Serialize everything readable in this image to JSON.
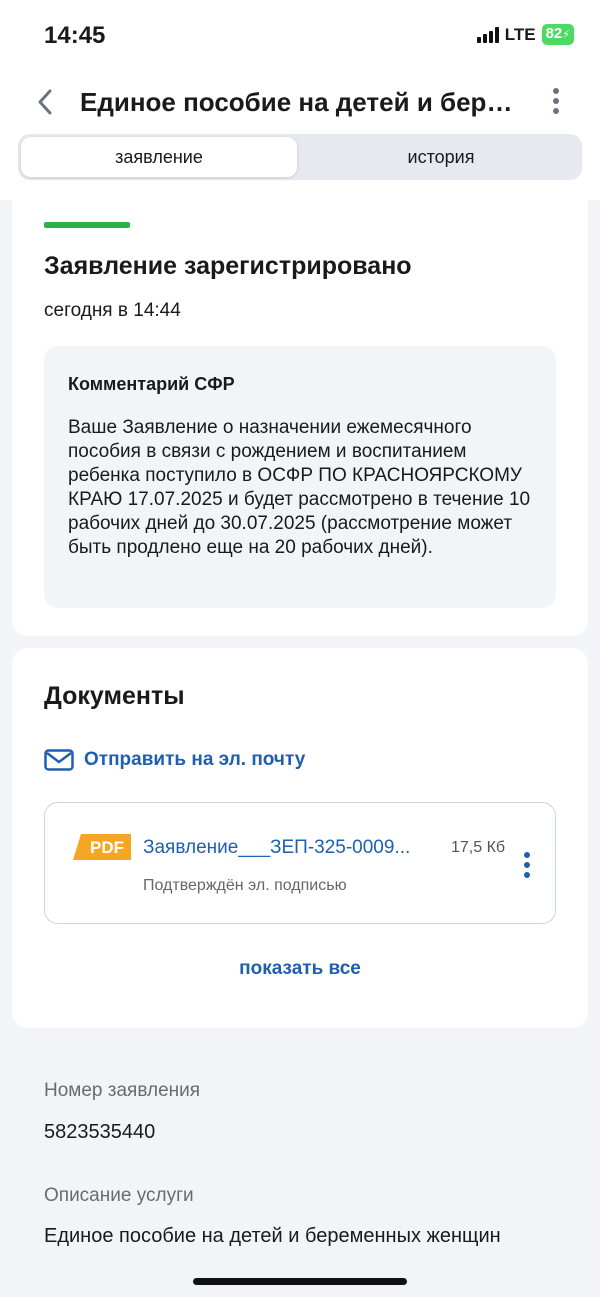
{
  "status_bar": {
    "time": "14:45",
    "network": "LTE",
    "battery": "82"
  },
  "header": {
    "back_icon": "chevron-left-icon",
    "title": "Единое пособие на детей и бере...",
    "more_icon": "more-vertical-icon"
  },
  "tabs": [
    {
      "label": "заявление",
      "active": true
    },
    {
      "label": "история",
      "active": false
    }
  ],
  "status_card": {
    "accent_color": "#2bb34a",
    "title": "Заявление зарегистрировано",
    "date": "сегодня в 14:44",
    "comment": {
      "title": "Комментарий СФР",
      "text": "Ваше Заявление о назначении ежемесячного пособия в связи с рождением и воспитанием ребенка поступило в ОСФР ПО КРАСНОЯРСКОМУ КРАЮ 17.07.2025 и будет рассмотрено в течение 10 рабочих дней до 30.07.2025 (рассмотрение может быть продлено еще на 20 рабочих дней)."
    }
  },
  "documents": {
    "title": "Документы",
    "email_icon": "envelope-icon",
    "email_label": "Отправить на эл. почту",
    "files": [
      {
        "badge": "PDF",
        "name": "Заявление___ЗЕП-325-0009...",
        "size": "17,5 Кб",
        "signature": "Подтверждён эл. подписью"
      }
    ],
    "show_all": "показать все"
  },
  "details": {
    "number_label": "Номер заявления",
    "number_value": "5823535440",
    "service_label": "Описание услуги",
    "service_value": "Единое пособие на детей и беременных женщин"
  },
  "colors": {
    "link": "#1f5eb0",
    "pdf_badge": "#f5a623",
    "background": "#f2f4f8"
  }
}
